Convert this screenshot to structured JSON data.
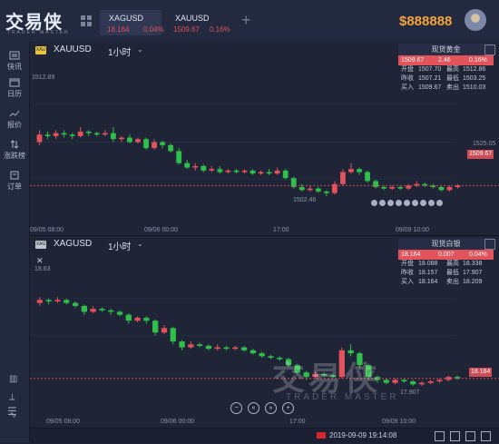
{
  "app": {
    "logo_text": "交易侠",
    "logo_sub": "TRADER MASTER",
    "balance": "$888888"
  },
  "tabs": [
    {
      "name": "XAGUSD",
      "price": "18.164",
      "pct": "0.04%"
    },
    {
      "name": "XAUUSD",
      "price": "1509.67",
      "pct": "0.16%"
    }
  ],
  "sidebar": {
    "items": [
      "快讯",
      "日历",
      "报价",
      "涨跌榜",
      "订单"
    ]
  },
  "chart1": {
    "tag": "XAU",
    "symbol": "XAUUSD",
    "timeframe": "1小时",
    "quote": {
      "title": "现货黄金",
      "price": "1509.67",
      "change": "2.46",
      "pct": "0.16%",
      "open_label": "开盘",
      "open": "1507.70",
      "high_label": "最高",
      "high": "1512.86",
      "prev_label": "昨收",
      "prev": "1507.21",
      "low_label": "最低",
      "low": "1503.25",
      "buy_label": "买入",
      "buy": "1509.67",
      "sell_label": "卖出",
      "sell": "1510.03"
    },
    "hi_label": "1512.89",
    "lo_label": "1502.46",
    "right_axis": "1525.05",
    "last_price": "1509.67",
    "x_labels": [
      "09/05 08:00",
      "09/06 00:00",
      "17:00",
      "09/09 10:00"
    ],
    "candles": [
      [
        0.5,
        0.55,
        0.58,
        0.48
      ],
      [
        0.55,
        0.54,
        0.57,
        0.52
      ],
      [
        0.54,
        0.56,
        0.58,
        0.52
      ],
      [
        0.56,
        0.55,
        0.58,
        0.53
      ],
      [
        0.55,
        0.54,
        0.56,
        0.52
      ],
      [
        0.54,
        0.57,
        0.6,
        0.53
      ],
      [
        0.57,
        0.56,
        0.58,
        0.54
      ],
      [
        0.56,
        0.55,
        0.57,
        0.54
      ],
      [
        0.55,
        0.56,
        0.58,
        0.54
      ],
      [
        0.56,
        0.52,
        0.6,
        0.5
      ],
      [
        0.52,
        0.53,
        0.54,
        0.5
      ],
      [
        0.53,
        0.5,
        0.55,
        0.49
      ],
      [
        0.5,
        0.52,
        0.53,
        0.49
      ],
      [
        0.52,
        0.46,
        0.53,
        0.45
      ],
      [
        0.46,
        0.5,
        0.52,
        0.45
      ],
      [
        0.5,
        0.48,
        0.51,
        0.46
      ],
      [
        0.48,
        0.44,
        0.49,
        0.43
      ],
      [
        0.44,
        0.36,
        0.46,
        0.35
      ],
      [
        0.36,
        0.33,
        0.38,
        0.32
      ],
      [
        0.33,
        0.34,
        0.36,
        0.31
      ],
      [
        0.34,
        0.31,
        0.35,
        0.3
      ],
      [
        0.31,
        0.32,
        0.34,
        0.3
      ],
      [
        0.32,
        0.3,
        0.34,
        0.29
      ],
      [
        0.3,
        0.31,
        0.32,
        0.29
      ],
      [
        0.31,
        0.3,
        0.32,
        0.29
      ],
      [
        0.3,
        0.31,
        0.32,
        0.29
      ],
      [
        0.31,
        0.29,
        0.32,
        0.28
      ],
      [
        0.29,
        0.3,
        0.31,
        0.28
      ],
      [
        0.3,
        0.29,
        0.32,
        0.28
      ],
      [
        0.29,
        0.31,
        0.33,
        0.28
      ],
      [
        0.31,
        0.26,
        0.32,
        0.25
      ],
      [
        0.26,
        0.2,
        0.27,
        0.19
      ],
      [
        0.2,
        0.18,
        0.22,
        0.17
      ],
      [
        0.18,
        0.19,
        0.21,
        0.17
      ],
      [
        0.19,
        0.17,
        0.2,
        0.16
      ],
      [
        0.17,
        0.16,
        0.18,
        0.14
      ],
      [
        0.16,
        0.22,
        0.24,
        0.15
      ],
      [
        0.22,
        0.3,
        0.32,
        0.21
      ],
      [
        0.3,
        0.32,
        0.36,
        0.29
      ],
      [
        0.32,
        0.3,
        0.33,
        0.28
      ],
      [
        0.3,
        0.24,
        0.31,
        0.23
      ],
      [
        0.24,
        0.2,
        0.25,
        0.19
      ],
      [
        0.2,
        0.19,
        0.21,
        0.18
      ],
      [
        0.19,
        0.2,
        0.21,
        0.18
      ],
      [
        0.2,
        0.19,
        0.21,
        0.18
      ],
      [
        0.19,
        0.21,
        0.22,
        0.18
      ],
      [
        0.21,
        0.22,
        0.24,
        0.2
      ],
      [
        0.22,
        0.21,
        0.23,
        0.2
      ],
      [
        0.21,
        0.2,
        0.22,
        0.19
      ],
      [
        0.2,
        0.18,
        0.21,
        0.17
      ],
      [
        0.18,
        0.2,
        0.21,
        0.17
      ],
      [
        0.2,
        0.21,
        0.22,
        0.19
      ]
    ]
  },
  "chart2": {
    "tag": "XAG",
    "symbol": "XAGUSD",
    "timeframe": "1小时",
    "quote": {
      "title": "现货白银",
      "price": "18.164",
      "change": "0.007",
      "pct": "0.04%",
      "open_label": "开盘",
      "open": "18.088",
      "high_label": "最高",
      "high": "18.338",
      "prev_label": "昨收",
      "prev": "18.157",
      "low_label": "最低",
      "low": "17.907",
      "buy_label": "买入",
      "buy": "18.164",
      "sell_label": "卖出",
      "sell": "18.209"
    },
    "hi_label": "18.63",
    "lo_label": "17.907",
    "last_price": "18.164",
    "x_labels": [
      "09/05 08:00",
      "09/06 00:00",
      "17:00",
      "09/09 10:00"
    ],
    "candles": [
      [
        0.72,
        0.74,
        0.76,
        0.7
      ],
      [
        0.74,
        0.73,
        0.75,
        0.71
      ],
      [
        0.73,
        0.74,
        0.76,
        0.72
      ],
      [
        0.74,
        0.72,
        0.75,
        0.71
      ],
      [
        0.72,
        0.7,
        0.73,
        0.69
      ],
      [
        0.7,
        0.66,
        0.71,
        0.64
      ],
      [
        0.66,
        0.68,
        0.7,
        0.65
      ],
      [
        0.68,
        0.67,
        0.69,
        0.66
      ],
      [
        0.67,
        0.66,
        0.68,
        0.64
      ],
      [
        0.66,
        0.64,
        0.67,
        0.63
      ],
      [
        0.64,
        0.6,
        0.65,
        0.58
      ],
      [
        0.6,
        0.62,
        0.63,
        0.59
      ],
      [
        0.62,
        0.6,
        0.63,
        0.58
      ],
      [
        0.6,
        0.52,
        0.61,
        0.5
      ],
      [
        0.52,
        0.55,
        0.57,
        0.51
      ],
      [
        0.55,
        0.46,
        0.56,
        0.44
      ],
      [
        0.46,
        0.42,
        0.47,
        0.4
      ],
      [
        0.42,
        0.44,
        0.46,
        0.41
      ],
      [
        0.44,
        0.43,
        0.45,
        0.42
      ],
      [
        0.43,
        0.41,
        0.44,
        0.4
      ],
      [
        0.41,
        0.42,
        0.44,
        0.4
      ],
      [
        0.42,
        0.41,
        0.43,
        0.4
      ],
      [
        0.41,
        0.42,
        0.43,
        0.4
      ],
      [
        0.42,
        0.4,
        0.43,
        0.39
      ],
      [
        0.4,
        0.38,
        0.41,
        0.37
      ],
      [
        0.38,
        0.36,
        0.39,
        0.35
      ],
      [
        0.36,
        0.35,
        0.37,
        0.34
      ],
      [
        0.35,
        0.34,
        0.36,
        0.33
      ],
      [
        0.34,
        0.3,
        0.35,
        0.29
      ],
      [
        0.3,
        0.25,
        0.31,
        0.24
      ],
      [
        0.25,
        0.22,
        0.26,
        0.2
      ],
      [
        0.22,
        0.24,
        0.26,
        0.21
      ],
      [
        0.24,
        0.23,
        0.25,
        0.22
      ],
      [
        0.23,
        0.22,
        0.24,
        0.21
      ],
      [
        0.22,
        0.4,
        0.42,
        0.21
      ],
      [
        0.4,
        0.38,
        0.44,
        0.36
      ],
      [
        0.38,
        0.3,
        0.39,
        0.28
      ],
      [
        0.3,
        0.22,
        0.31,
        0.2
      ],
      [
        0.22,
        0.2,
        0.23,
        0.18
      ],
      [
        0.2,
        0.18,
        0.21,
        0.17
      ],
      [
        0.18,
        0.2,
        0.21,
        0.17
      ],
      [
        0.2,
        0.19,
        0.21,
        0.18
      ],
      [
        0.19,
        0.17,
        0.2,
        0.16
      ],
      [
        0.17,
        0.18,
        0.19,
        0.16
      ],
      [
        0.18,
        0.19,
        0.2,
        0.17
      ],
      [
        0.19,
        0.2,
        0.21,
        0.18
      ],
      [
        0.2,
        0.22,
        0.23,
        0.19
      ],
      [
        0.22,
        0.21,
        0.23,
        0.2
      ]
    ]
  },
  "status": {
    "time": "2019-09-09 19:14:08"
  },
  "colors": {
    "up": "#e2535b",
    "down": "#2fbf4b",
    "bg": "#1f2437",
    "panel": "#232a40",
    "accent": "#f3a53a"
  }
}
